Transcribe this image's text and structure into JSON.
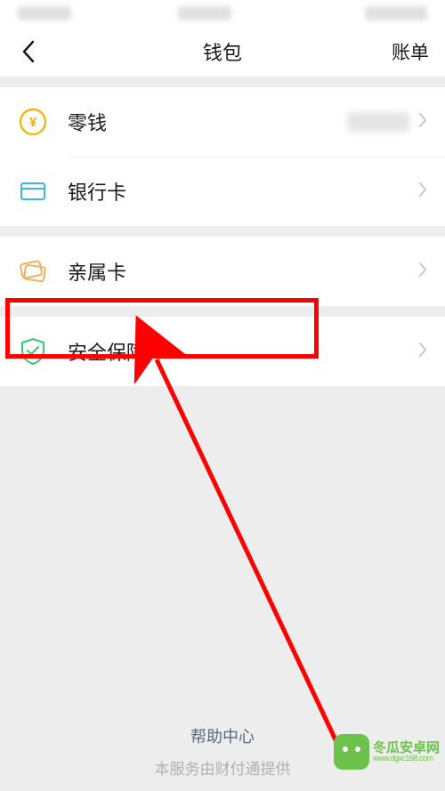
{
  "nav": {
    "title": "钱包",
    "action": "账单"
  },
  "items": {
    "balance": {
      "label": "零钱"
    },
    "cards": {
      "label": "银行卡"
    },
    "family": {
      "label": "亲属卡"
    },
    "security": {
      "label": "安全保障"
    }
  },
  "footer": {
    "help": "帮助中心",
    "note": "本服务由财付通提供"
  },
  "watermark": {
    "name": "冬瓜安卓网",
    "url": "www.dgxc168.com"
  }
}
